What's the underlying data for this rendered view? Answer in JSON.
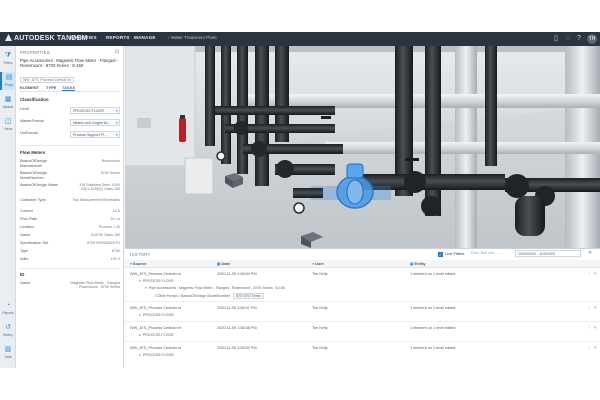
{
  "app": {
    "brand": "AUTODESK TANDEM",
    "nav": [
      "FACILITIES",
      "REPORTS",
      "MANAGE"
    ],
    "facility": "Water Treatment Plant",
    "avatar_initials": "TH"
  },
  "rail": [
    {
      "icon": "filter-icon",
      "glyph": "⧩",
      "label": "Filters"
    },
    {
      "icon": "properties-icon",
      "glyph": "▤",
      "label": "Props"
    },
    {
      "icon": "model-icon",
      "glyph": "▦",
      "label": "Models"
    },
    {
      "icon": "views-icon",
      "glyph": "◫",
      "label": "Views"
    },
    {
      "icon": "reports-icon",
      "glyph": "◔",
      "label": "Reports"
    },
    {
      "icon": "history-icon",
      "glyph": "↺",
      "label": "History"
    },
    {
      "icon": "data-icon",
      "glyph": "▥",
      "label": "Data"
    }
  ],
  "properties": {
    "title": "PROPERTIES",
    "object_name": "Pipe Accessories : Magnetic Flow Meter - Flanged - Rosemount - 8700 Series : 8-150",
    "object_sub": "WW_ATS_Process Central.rvt",
    "tabs": [
      "ELEMENT",
      "TYPE",
      "TASKS"
    ],
    "classification_heading": "Classification",
    "classification": [
      {
        "key": "Level",
        "value": "PROCESS FLOOR"
      },
      {
        "key": "MasterFormat",
        "value": "Meters and Gages for..."
      },
      {
        "key": "UniFormat",
        "value": "Process Support Pl..."
      }
    ],
    "flow_heading": "Flow Meters",
    "flow": [
      {
        "key": "BasicsOfDesign Manufacturer",
        "value": "Rosemount"
      },
      {
        "key": "BasicsOfDesign ModelNumber",
        "value": "8700 Series"
      },
      {
        "key": "BasicsOfDesign Notes",
        "value": "316 Stainless Steel, 4100 EN/1.4436(S) Class 150"
      },
      {
        "key": "Controller Type",
        "value": "Two Measurement Electrodes"
      },
      {
        "key": "Current",
        "value": "12 A"
      },
      {
        "key": "Flow Rate",
        "value": "20 L/s"
      },
      {
        "key": "Location",
        "value": "Process 1.30"
      },
      {
        "key": "Name",
        "value": "B-8700 Class 150"
      },
      {
        "key": "Specification Set",
        "value": "8700TSHS5000STD"
      },
      {
        "key": "Type",
        "value": "8700"
      },
      {
        "key": "Volts",
        "value": "120 V"
      }
    ],
    "id_heading": "ID",
    "id_rows": [
      {
        "key": "Name",
        "value": "Magnetic Flow Meter - Flanged - Rosemount - 8700 Series"
      }
    ]
  },
  "history": {
    "title": "HISTORY",
    "live_filters": "Live Filters",
    "filter_placeholder": "Enter filter text...",
    "date_range": "10/29/2020 - 11/5/2020",
    "columns": [
      "Source",
      "Date",
      "User",
      "Entity"
    ],
    "rows": [
      {
        "source": "WW_ATS_Process Central.rvt",
        "date": "2020-11-05 1:58:54 PM",
        "user": "Tim Kelly",
        "entity": "1 element on 1 level edited",
        "subs": [
          {
            "text": "PROCESS FLOOR"
          },
          {
            "text": "Pipe Accessories : Magnetic Flow Meter - Flanged - Rosemount - 8700 Series : 8-150"
          },
          {
            "text": "COBie Pumps / BasicsOfDesign ModelNumber",
            "chip": "8700 8700 Series"
          }
        ]
      },
      {
        "source": "WW_ATS_Process Central.rvt",
        "date": "2020-11-05 1:58:47 PM",
        "user": "Tim Kelly",
        "entity": "1 element on 1 level edited",
        "subs": [
          {
            "text": "PROCESS FLOOR"
          }
        ]
      },
      {
        "source": "WW_ATS_Process Central.rvt",
        "date": "2020-11-05 1:58:38 PM",
        "user": "Tim Kelly",
        "entity": "1 element on 1 level edited",
        "subs": [
          {
            "text": "PROCESS FLOOR"
          }
        ]
      },
      {
        "source": "WW_ATS_Process Central.rvt",
        "date": "2020-11-05 1:58:32 PM",
        "user": "Tim Kelly",
        "entity": "1 element on 1 level edited",
        "subs": [
          {
            "text": "PROCESS FLOOR"
          }
        ]
      }
    ]
  },
  "colors": {
    "topbar": "#2b3440",
    "accent": "#1f7fc9",
    "selection": "#3b8fe0",
    "pipe": "#2a2d31",
    "floor": "#c9ced2"
  }
}
